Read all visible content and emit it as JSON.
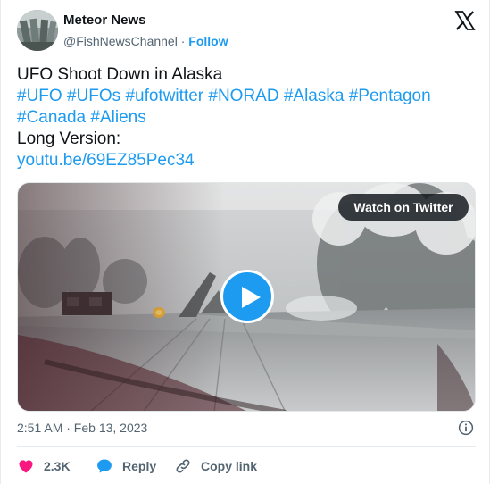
{
  "author": {
    "name": "Meteor News",
    "handle": "@FishNewsChannel",
    "separator": "·",
    "follow_label": "Follow"
  },
  "tweet": {
    "title": "UFO Shoot Down in Alaska",
    "hashtags": [
      "#UFO",
      "#UFOs",
      "#ufotwitter",
      "#NORAD",
      "#Alaska",
      "#Pentagon",
      "#Canada",
      "#Aliens"
    ],
    "long_version_label": "Long Version:",
    "link": "youtu.be/69EZ85Pec34"
  },
  "media": {
    "watch_label": "Watch on Twitter",
    "play_icon": "play-icon"
  },
  "timestamp": "2:51 AM · Feb 13, 2023",
  "actions": {
    "like_count": "2.3K",
    "reply_label": "Reply",
    "copy_link_label": "Copy link"
  },
  "colors": {
    "accent": "#1d9bf0",
    "like": "#f91880",
    "secondary_text": "#536471"
  }
}
